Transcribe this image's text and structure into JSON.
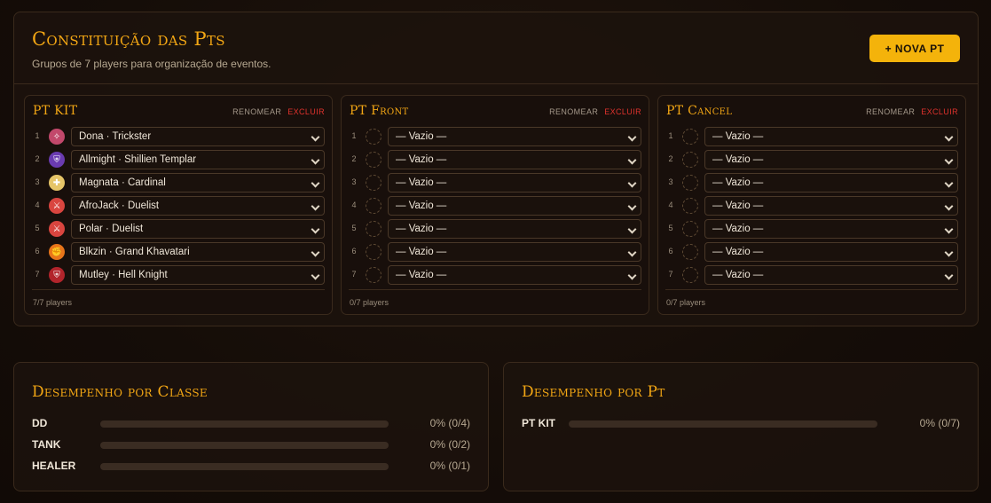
{
  "header": {
    "title": "Constituição das Pts",
    "subtitle": "Grupos de 7 players para organização de eventos.",
    "new_button": "+ NOVA PT"
  },
  "actions": {
    "rename": "RENOMEAR",
    "delete": "EXCLUIR"
  },
  "pts": [
    {
      "name": "PT KIT",
      "count": "7/7 players",
      "slots": [
        {
          "num": "1",
          "value": "Dona · Trickster",
          "icon": "trickster-icon",
          "color": "#c2486b"
        },
        {
          "num": "2",
          "value": "Allmight · Shillien Templar",
          "icon": "shield-icon",
          "color": "#6a3bb0"
        },
        {
          "num": "3",
          "value": "Magnata · Cardinal",
          "icon": "cross-icon",
          "color": "#e6c568"
        },
        {
          "num": "4",
          "value": "AfroJack · Duelist",
          "icon": "swords-icon",
          "color": "#d9453f"
        },
        {
          "num": "5",
          "value": "Polar · Duelist",
          "icon": "swords-icon",
          "color": "#d9453f"
        },
        {
          "num": "6",
          "value": "Blkzin · Grand Khavatari",
          "icon": "fist-icon",
          "color": "#e8751a"
        },
        {
          "num": "7",
          "value": "Mutley · Hell Knight",
          "icon": "shield-icon",
          "color": "#b2242b"
        }
      ]
    },
    {
      "name": "PT Front",
      "count": "0/7 players",
      "slots": [
        {
          "num": "1",
          "value": "— Vazio —"
        },
        {
          "num": "2",
          "value": "— Vazio —"
        },
        {
          "num": "3",
          "value": "— Vazio —"
        },
        {
          "num": "4",
          "value": "— Vazio —"
        },
        {
          "num": "5",
          "value": "— Vazio —"
        },
        {
          "num": "6",
          "value": "— Vazio —"
        },
        {
          "num": "7",
          "value": "— Vazio —"
        }
      ]
    },
    {
      "name": "PT Cancel",
      "count": "0/7 players",
      "slots": [
        {
          "num": "1",
          "value": "— Vazio —"
        },
        {
          "num": "2",
          "value": "— Vazio —"
        },
        {
          "num": "3",
          "value": "— Vazio —"
        },
        {
          "num": "4",
          "value": "— Vazio —"
        },
        {
          "num": "5",
          "value": "— Vazio —"
        },
        {
          "num": "6",
          "value": "— Vazio —"
        },
        {
          "num": "7",
          "value": "— Vazio —"
        }
      ]
    }
  ],
  "perf_class": {
    "title": "Desempenho por Classe",
    "rows": [
      {
        "label": "DD",
        "value": "0% (0/4)",
        "fraction": 0
      },
      {
        "label": "TANK",
        "value": "0% (0/2)",
        "fraction": 0
      },
      {
        "label": "HEALER",
        "value": "0% (0/1)",
        "fraction": 0
      }
    ]
  },
  "perf_pt": {
    "title": "Desempenho por Pt",
    "rows": [
      {
        "label": "PT KIT",
        "value": "0% (0/7)",
        "fraction": 0
      }
    ]
  },
  "colors": {
    "accent": "#f2a614",
    "danger": "#e0322d"
  }
}
